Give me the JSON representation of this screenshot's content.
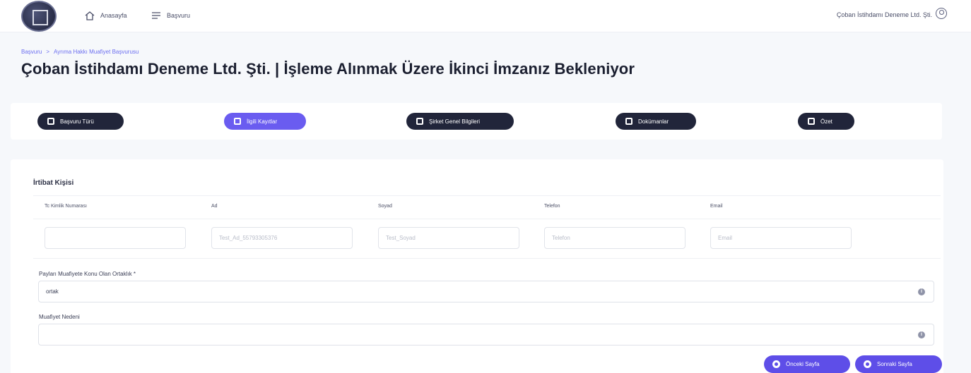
{
  "header": {
    "logo": "app-logo",
    "nav": [
      {
        "label": "Anasayfa",
        "icon": "home-icon"
      },
      {
        "label": "Başvuru",
        "icon": "menu-lines-icon"
      }
    ],
    "user_name": "Çoban İstihdamı Deneme Ltd. Şti.",
    "user_icon": "user-circle-icon"
  },
  "breadcrumb": {
    "items": [
      "Başvuru",
      "Ayrıma Hakkı Muafiyet Başvurusu"
    ],
    "separator": ">"
  },
  "page_title": "Çoban İstihdamı Deneme Ltd. Şti. | İşleme Alınmak Üzere İkinci İmzanız Bekleniyor",
  "steps": [
    {
      "label": "Başvuru Türü",
      "active": false
    },
    {
      "label": "İlgili Kayıtlar",
      "active": true
    },
    {
      "label": "Şirket Genel Bilgileri",
      "active": false
    },
    {
      "label": "Dokümanlar",
      "active": false
    },
    {
      "label": "Özet",
      "active": false
    }
  ],
  "contact": {
    "title": "İrtibat Kişisi",
    "columns": [
      "Tc Kimlik Numarası",
      "Ad",
      "Soyad",
      "Telefon",
      "Email"
    ],
    "values": [
      "",
      "Test_Ad_55793305376",
      "Test_Soyad",
      "",
      ""
    ],
    "placeholders": [
      "",
      "",
      "",
      "Telefon",
      "Email"
    ]
  },
  "partnership": {
    "label": "Payları Muafiyete Konu Olan Ortaklık *",
    "value": "ortak"
  },
  "exemption_reason": {
    "label": "Muafiyet Nedeni",
    "value": ""
  },
  "buttons": {
    "prev": "Önceki Sayfa",
    "next": "Sonraki Sayfa"
  },
  "colors": {
    "accent": "#6a5cf0",
    "step_dark": "#21253a",
    "button": "#5e4ee8"
  }
}
